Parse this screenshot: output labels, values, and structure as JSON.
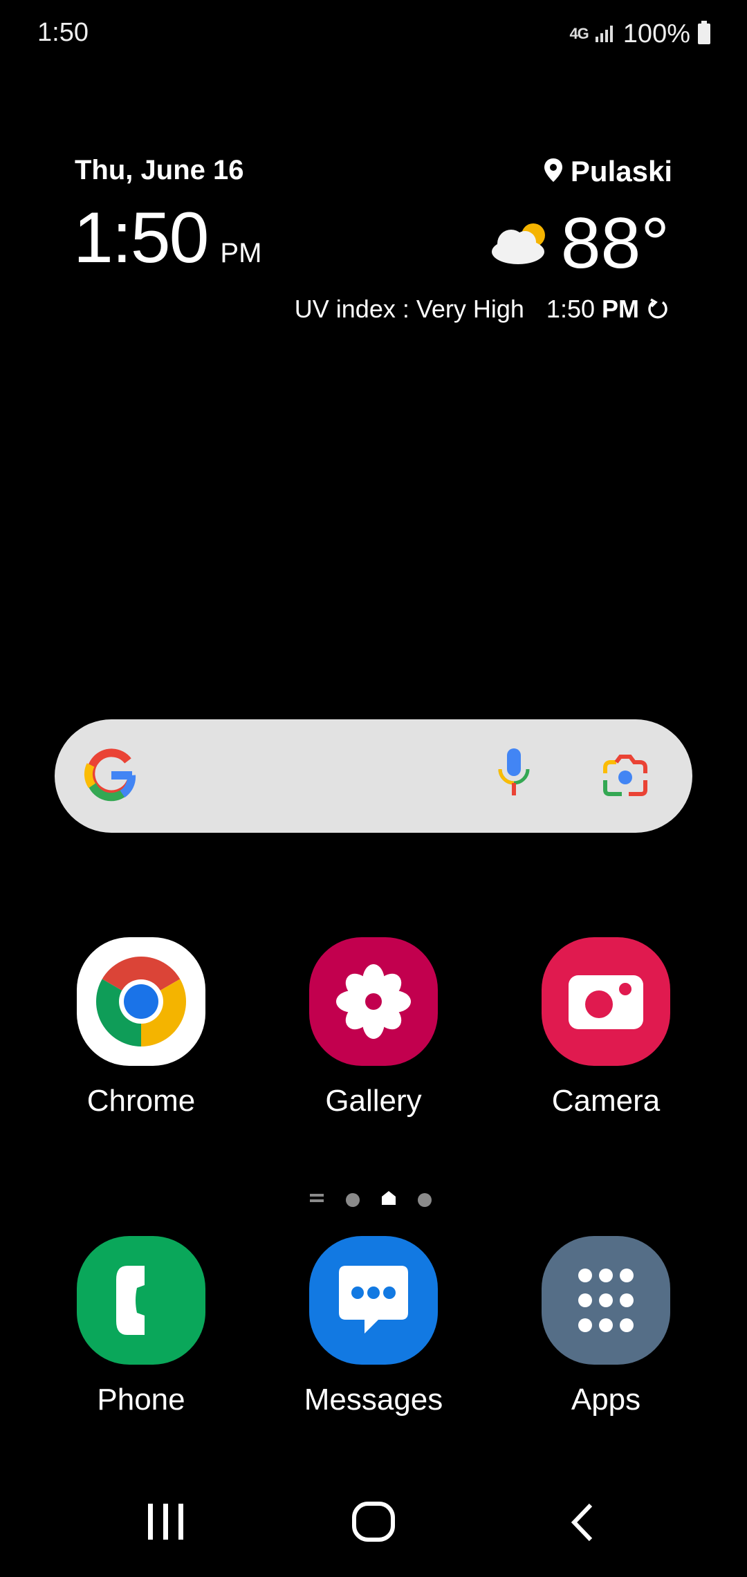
{
  "status_bar": {
    "time": "1:50",
    "network": "4G",
    "battery": "100%"
  },
  "clock_widget": {
    "date": "Thu, June 16",
    "time": "1:50",
    "ampm": "PM"
  },
  "weather_widget": {
    "location": "Pulaski",
    "temperature": "88°",
    "uv_index": "UV index : Very High",
    "updated_time": "1:50",
    "updated_ampm": "PM",
    "icon": "partly-cloudy-icon"
  },
  "search_bar": {
    "logo": "google-g-icon",
    "voice_icon": "mic-icon",
    "lens_icon": "google-lens-icon"
  },
  "apps": {
    "chrome": "Chrome",
    "gallery": "Gallery",
    "camera": "Camera"
  },
  "dock": {
    "phone": "Phone",
    "messages": "Messages",
    "apps": "Apps"
  },
  "page_indicator": {
    "pages": [
      "menu",
      "dot",
      "home",
      "dot"
    ],
    "current": "home"
  },
  "colors": {
    "gallery": "#c2004e",
    "camera": "#e01a4f",
    "phone": "#0aa75a",
    "messages": "#1279e2",
    "apps": "#556e87",
    "search_bar": "#e2e2e2"
  }
}
